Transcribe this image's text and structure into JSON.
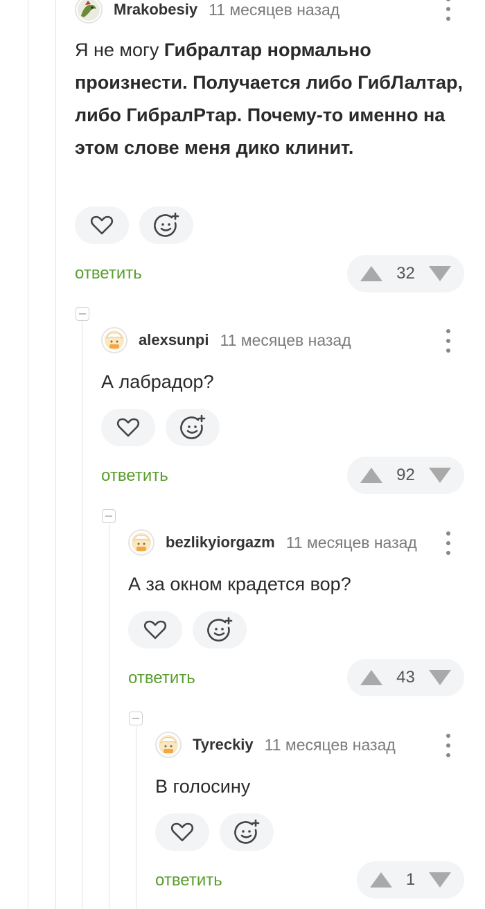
{
  "comments": [
    {
      "username": "Mrakobesiy",
      "time": "11 месяцев назад",
      "text_parts": [
        {
          "t": "Я не могу ",
          "b": false
        },
        {
          "t": "Гибралтар нормально произнести. Получается либо ГибЛалтар, либо ГибралРтар. Почему-то именно на этом слове меня дико клинит.",
          "b": true
        }
      ],
      "reply_label": "ответить",
      "score": "32"
    },
    {
      "username": "alexsunpi",
      "time": "11 месяцев назад",
      "text": "А лабрадор?",
      "reply_label": "ответить",
      "score": "92"
    },
    {
      "username": "bezlikyiorgazm",
      "time": "11 месяцев назад",
      "text": "А за окном крадется вор?",
      "reply_label": "ответить",
      "score": "43"
    },
    {
      "username": "Tyreckiy",
      "time": "11 месяцев назад",
      "text": "В голосину",
      "reply_label": "ответить",
      "score": "1"
    }
  ],
  "icons": {
    "like": "heart-icon",
    "react": "smiley-plus-icon",
    "upvote": "triangle-up-icon",
    "downvote": "triangle-down-icon",
    "more": "kebab-menu-icon",
    "collapse": "collapse-minus-icon"
  },
  "colors": {
    "reply": "#5a9e2f",
    "pill_bg": "#f3f4f6",
    "vote_arrow": "#a9a9a9",
    "time": "#7a7a7a"
  }
}
